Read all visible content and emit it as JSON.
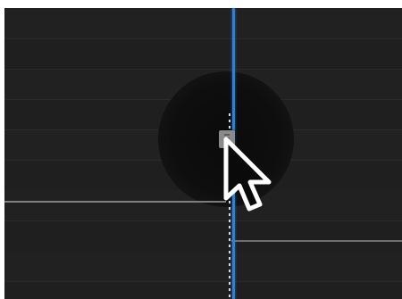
{
  "timeline": {
    "background_color": "#1f1f1f",
    "playhead_color": "#2f7fd6",
    "edge_line_color": "#8f8f8f"
  },
  "icons": {
    "cursor": "arrow-cursor-icon",
    "handle": "grab-handle-icon"
  }
}
